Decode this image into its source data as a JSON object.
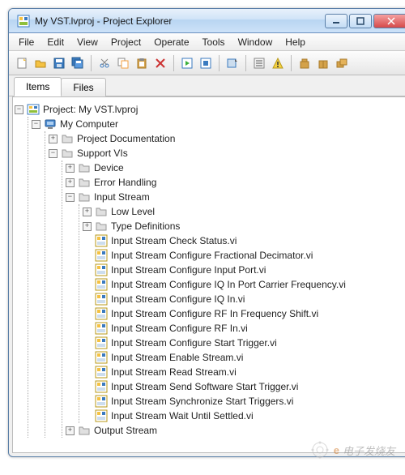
{
  "window": {
    "title": "My VST.lvproj - Project Explorer"
  },
  "menu": {
    "file": "File",
    "edit": "Edit",
    "view": "View",
    "project": "Project",
    "operate": "Operate",
    "tools": "Tools",
    "window": "Window",
    "help": "Help"
  },
  "tabs": {
    "items": "Items",
    "files": "Files"
  },
  "tree": {
    "project": "Project: My VST.lvproj",
    "my_computer": "My Computer",
    "project_doc": "Project Documentation",
    "support_vis": "Support VIs",
    "device": "Device",
    "error_handling": "Error Handling",
    "input_stream": "Input Stream",
    "low_level": "Low Level",
    "type_defs": "Type Definitions",
    "output_stream": "Output Stream",
    "vis": [
      "Input Stream Check Status.vi",
      "Input Stream Configure Fractional Decimator.vi",
      "Input Stream Configure Input Port.vi",
      "Input Stream Configure IQ In Port Carrier Frequency.vi",
      "Input Stream Configure IQ In.vi",
      "Input Stream Configure RF In Frequency Shift.vi",
      "Input Stream Configure RF In.vi",
      "Input Stream Configure Start Trigger.vi",
      "Input Stream Enable Stream.vi",
      "Input Stream Read Stream.vi",
      "Input Stream Send Software Start Trigger.vi",
      "Input Stream Synchronize Start Triggers.vi",
      "Input Stream Wait Until Settled.vi"
    ]
  },
  "watermark": "电子发烧友"
}
